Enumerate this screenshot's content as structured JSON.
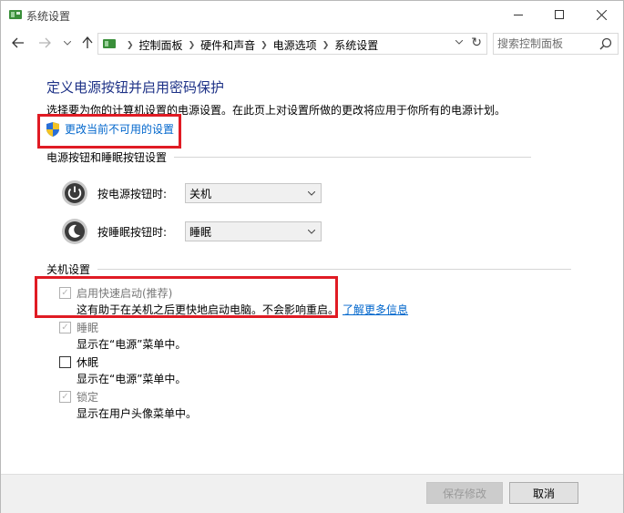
{
  "window": {
    "title": "系统设置",
    "icon": "control-panel-icon"
  },
  "navbar": {
    "breadcrumbs": [
      "控制面板",
      "硬件和声音",
      "电源选项",
      "系统设置"
    ],
    "search_placeholder": "搜索控制面板"
  },
  "main": {
    "page_title": "定义电源按钮并启用密码保护",
    "description": "选择要为你的计算机设置的电源设置。在此页上对设置所做的更改将应用于你所有的电源计划。",
    "change_unavailable_label": "更改当前不可用的设置",
    "power_section": {
      "heading": "电源按钮和睡眠按钮设置",
      "rows": [
        {
          "label": "按电源按钮时:",
          "value": "关机"
        },
        {
          "label": "按睡眠按钮时:",
          "value": "睡眠"
        }
      ]
    },
    "shutdown_section": {
      "heading": "关机设置",
      "options": [
        {
          "label": "启用快速启动(推荐)",
          "description": "这有助于在关机之后更快地启动电脑。不会影响重启。",
          "link": "了解更多信息",
          "checked": true,
          "enabled": false
        },
        {
          "label": "睡眠",
          "description": "显示在“电源”菜单中。",
          "checked": true,
          "enabled": false
        },
        {
          "label": "休眠",
          "description": "显示在“电源”菜单中。",
          "checked": false,
          "enabled": true
        },
        {
          "label": "锁定",
          "description": "显示在用户头像菜单中。",
          "checked": true,
          "enabled": false
        }
      ]
    }
  },
  "footer": {
    "save_label": "保存修改",
    "cancel_label": "取消"
  },
  "colors": {
    "title_blue": "#1e3287",
    "link_blue": "#0066cc",
    "highlight_red": "#e01b24"
  }
}
